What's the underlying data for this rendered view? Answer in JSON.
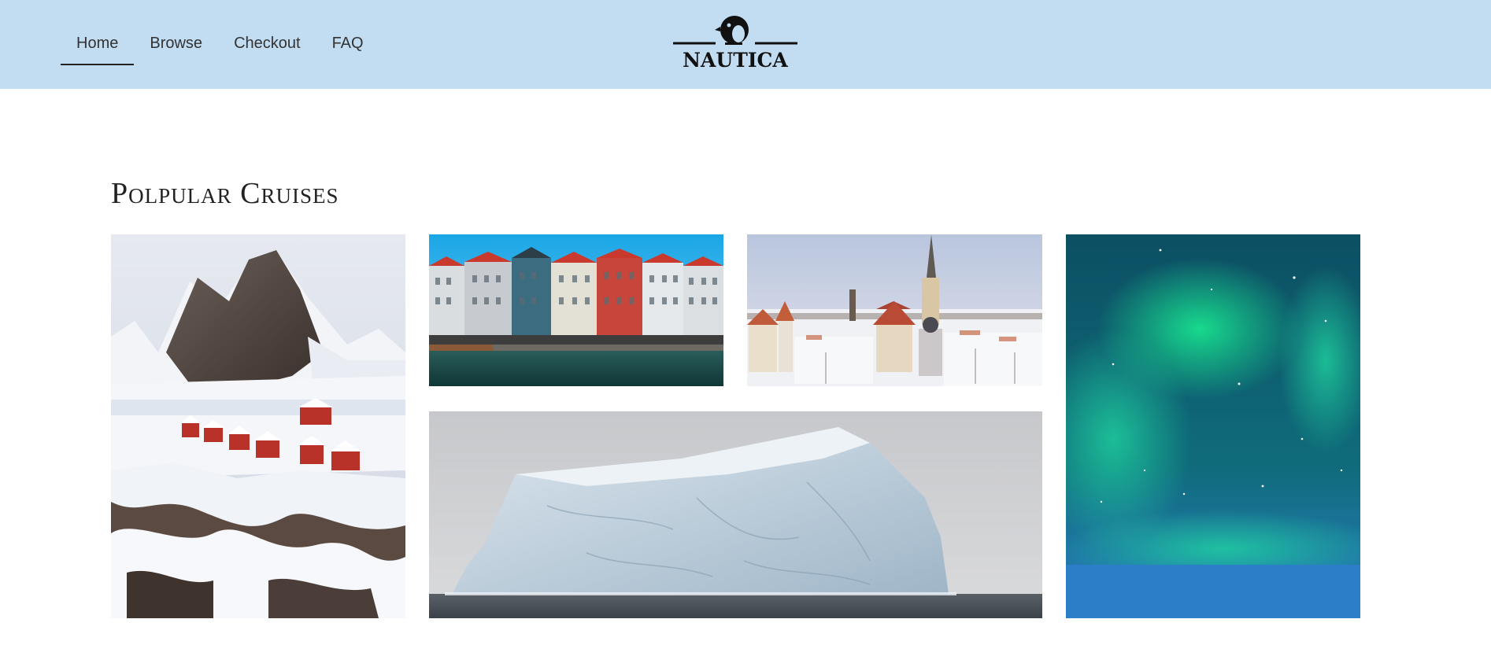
{
  "nav": {
    "items": [
      {
        "label": "Home",
        "active": true
      },
      {
        "label": "Browse",
        "active": false
      },
      {
        "label": "Checkout",
        "active": false
      },
      {
        "label": "FAQ",
        "active": false
      }
    ]
  },
  "brand": {
    "name": "NAUTICA",
    "icon": "penguin-icon"
  },
  "section": {
    "title": "Polpular Cruises"
  },
  "gallery": {
    "tiles": [
      {
        "icon": "mountain-village-photo"
      },
      {
        "icon": "harbor-houses-photo"
      },
      {
        "icon": "snowy-old-town-photo"
      },
      {
        "icon": "iceberg-photo"
      },
      {
        "icon": "aurora-photo"
      }
    ]
  },
  "colors": {
    "header_bg": "#c2dcf2",
    "text": "#333333",
    "aurora_green": "#18e08f",
    "aurora_blue": "#2a7fc4"
  }
}
